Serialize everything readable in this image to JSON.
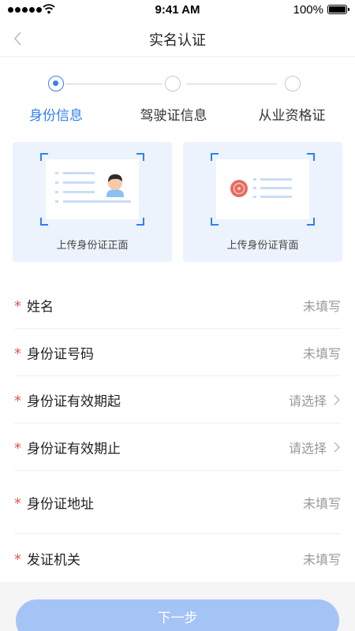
{
  "status_bar": {
    "time": "9:41 AM",
    "battery": "100%",
    "battery_level": 1.0
  },
  "nav": {
    "title": "实名认证",
    "back_icon": "chevron-left-icon"
  },
  "steps": [
    {
      "label": "身份信息",
      "active": true
    },
    {
      "label": "驾驶证信息",
      "active": false
    },
    {
      "label": "从业资格证",
      "active": false
    }
  ],
  "uploads": {
    "front_label": "上传身份证正面",
    "back_label": "上传身份证背面"
  },
  "form": {
    "required_mark": "*",
    "fields": [
      {
        "label": "姓名",
        "value": "未填写"
      },
      {
        "label": "身份证号码",
        "value": "未填写"
      },
      {
        "label": "身份证有效期起",
        "value": "请选择"
      },
      {
        "label": "身份证有效期止",
        "value": "请选择"
      },
      {
        "label": "身份证地址",
        "value": "未填写"
      },
      {
        "label": "发证机关",
        "value": "未填写"
      }
    ]
  },
  "footer": {
    "next_label": "下一步"
  },
  "colors": {
    "accent": "#2f7ff1",
    "required": "#e85050",
    "card_bg": "#ecf3fd",
    "button_disabled": "#a4c4f5"
  }
}
